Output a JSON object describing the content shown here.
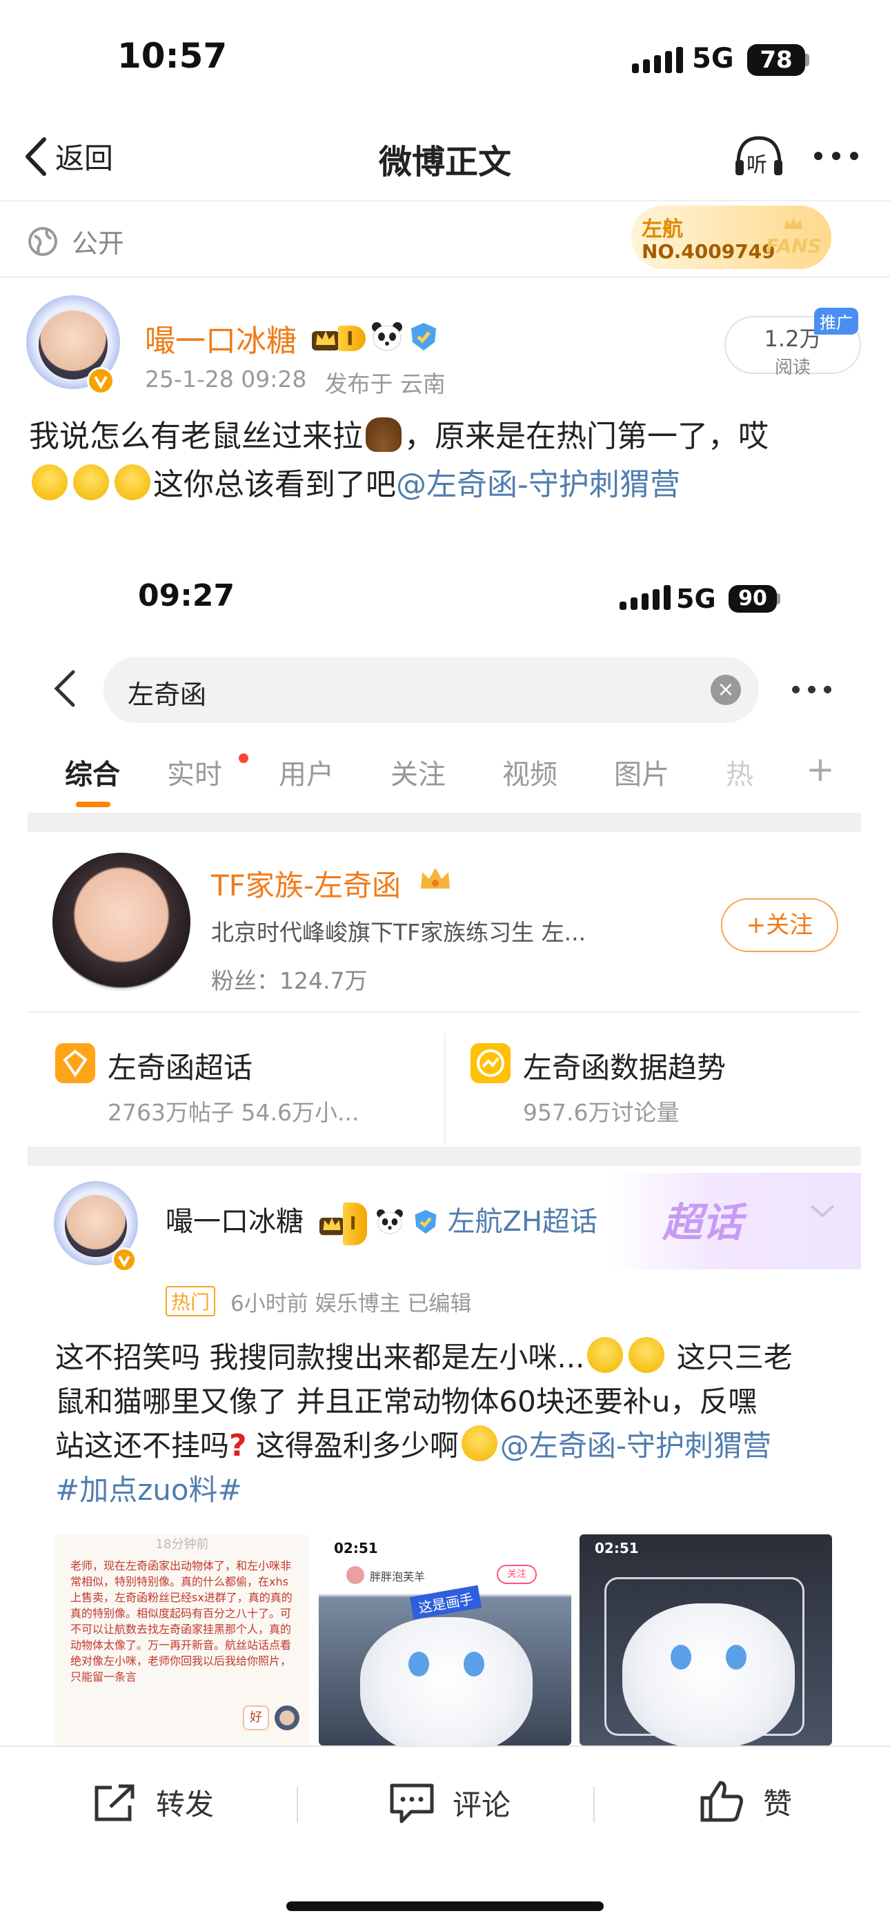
{
  "status_bar": {
    "time": "10:57",
    "network": "5G",
    "battery": "78"
  },
  "nav": {
    "back_label": "返回",
    "title": "微博正文",
    "listen_label": "听"
  },
  "visibility": {
    "label": "公开"
  },
  "fans_badge": {
    "name": "左航",
    "number": "NO.4009749",
    "tag": "FANS"
  },
  "author": {
    "name": "嘬一口冰糖",
    "level_badge": "I",
    "time": "25-1-28 09:28",
    "location": "发布于 云南",
    "read_count": "1.2万",
    "read_label": "阅读",
    "promo_label": "推广"
  },
  "post": {
    "text_1": "我说怎么有老鼠丝过来拉",
    "text_2": "，原来是在热门第一了，哎",
    "text_3": "这你总该看到了吧",
    "mention": "@左奇函-守护刺猬营"
  },
  "embedded": {
    "time": "09:27",
    "network": "5G",
    "battery": "90",
    "search_query": "左奇函",
    "tabs": [
      "综合",
      "实时",
      "用户",
      "关注",
      "视频",
      "图片",
      "热"
    ],
    "user_card": {
      "name": "TF家族-左奇函",
      "desc": "北京时代峰峻旗下TF家族练习生 左...",
      "fans": "粉丝：124.7万",
      "follow_label": "+关注"
    },
    "link_cards": [
      {
        "title": "左奇函超话",
        "sub": "2763万帖子  54.6万小..."
      },
      {
        "title": "左奇函数据趋势",
        "sub": "957.6万讨论量"
      }
    ],
    "post": {
      "author": "嘬一口冰糖",
      "supertopic": "左航ZH超话",
      "chaohua_label": "超话",
      "hot_tag": "热门",
      "meta": "6小时前  娱乐博主  已编辑",
      "line_1a": "这不招笑吗 我搜同款搜出来都是左小咪...",
      "line_1b": " 这只三老",
      "line_2": "鼠和猫哪里又像了  并且正常动物体60块还要补u，反嘿",
      "line_3a": "站这还不挂吗",
      "line_3b": " 这得盈利多少啊",
      "mention": "@左奇函-守护刺猬营",
      "hashtag": "#加点zuo料#"
    },
    "thumbs": {
      "note_text": "老师，现在左奇函家出动物体了，和左小咪非常相似，特别特别像。真的什么都偷，在xhs上售卖，左奇函粉丝已经sx进群了，真的真的真的特别像。相似度起码有百分之八十了。可不可以让航数去找左奇函家挂黑那个人，真的动物体太像了。万一再开新音。航丝站话点看绝对像左小咪，老师你回我以后我给你照片，只能留一条言",
      "note_header": "18分钟前",
      "shot_time": "02:51",
      "shot_user": "胖胖泡芙羊",
      "shot_follow": "关注",
      "shot_tag": "这是画手"
    }
  },
  "bottom_bar": {
    "repost": "转发",
    "comment": "评论",
    "like": "赞"
  }
}
